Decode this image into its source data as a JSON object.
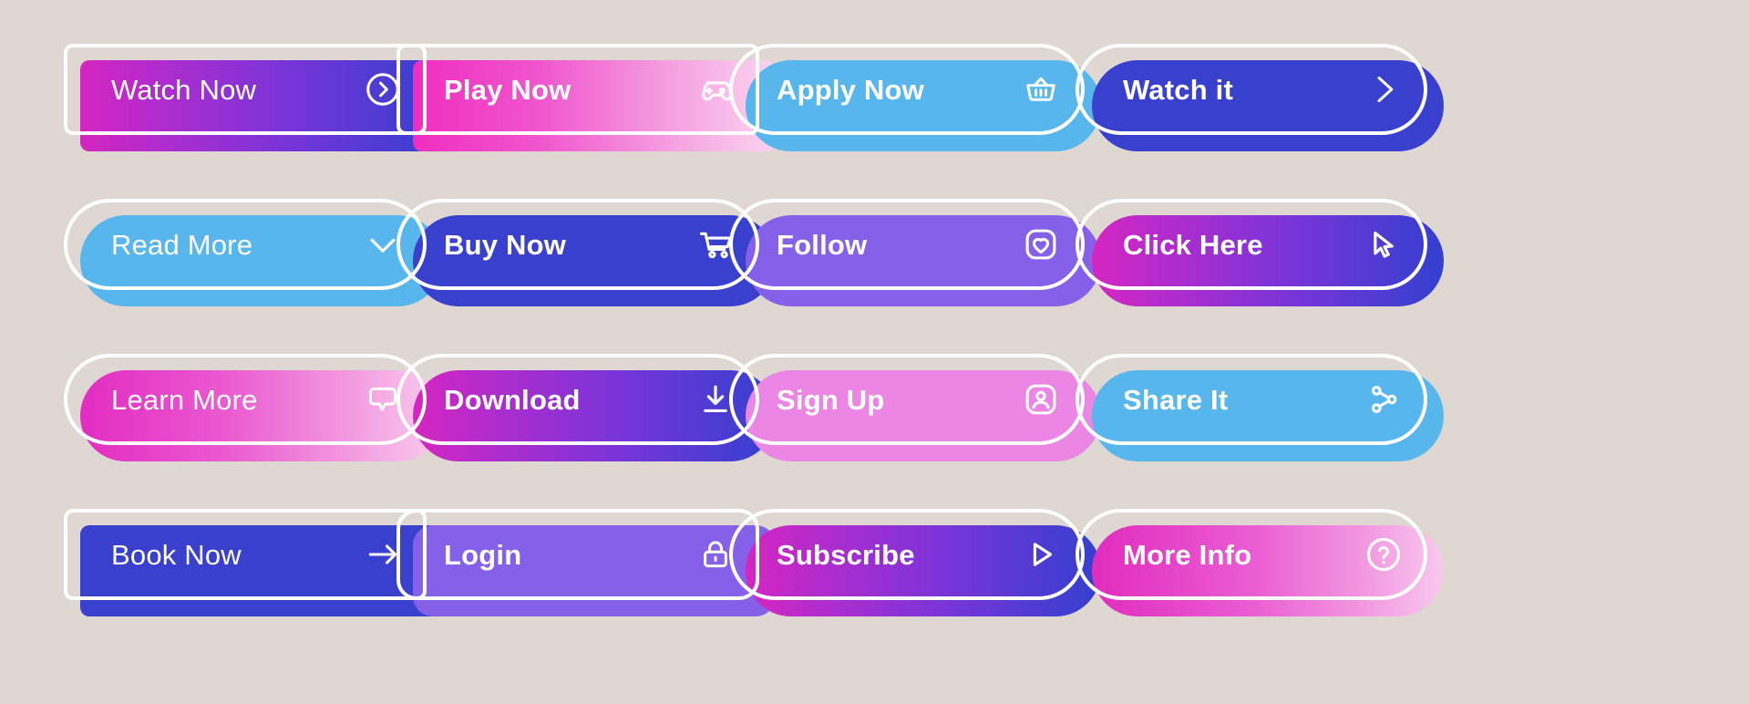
{
  "page": {
    "title": "CTA Button Set",
    "background_color": "#ded7d2",
    "columns": 4,
    "rows": 4,
    "button_count": 16
  },
  "buttons": [
    {
      "label": "Watch Now",
      "icon": "chevron-right-circle-icon",
      "shape": "rounded-small",
      "fill_style": "gradient",
      "colors": [
        "#d526c0",
        "#3340cf"
      ],
      "bold": false,
      "row": 1,
      "col": 1
    },
    {
      "label": "Play Now",
      "icon": "gamepad-icon",
      "shape": "rounded-small",
      "fill_style": "gradient",
      "colors": [
        "#ef2ec0",
        "#fbd4ef"
      ],
      "bold": true,
      "row": 1,
      "col": 2
    },
    {
      "label": "Apply Now",
      "icon": "shopping-basket-icon",
      "shape": "pill",
      "fill_style": "solid",
      "colors": [
        "#57b6ec"
      ],
      "bold": true,
      "row": 1,
      "col": 3
    },
    {
      "label": "Watch it",
      "icon": "chevron-right-icon",
      "shape": "pill",
      "fill_style": "solid",
      "colors": [
        "#3940ce"
      ],
      "bold": true,
      "row": 1,
      "col": 4
    },
    {
      "label": "Read More",
      "icon": "chevron-down-icon",
      "shape": "pill",
      "fill_style": "solid",
      "colors": [
        "#57b6ec"
      ],
      "bold": false,
      "row": 2,
      "col": 1
    },
    {
      "label": "Buy Now",
      "icon": "shopping-cart-icon",
      "shape": "pill",
      "fill_style": "solid",
      "colors": [
        "#3940ce"
      ],
      "bold": true,
      "row": 2,
      "col": 2
    },
    {
      "label": "Follow",
      "icon": "heart-square-icon",
      "shape": "pill",
      "fill_style": "solid",
      "colors": [
        "#8560e8"
      ],
      "bold": true,
      "row": 2,
      "col": 3
    },
    {
      "label": "Click Here",
      "icon": "cursor-pointer-icon",
      "shape": "pill",
      "fill_style": "gradient",
      "colors": [
        "#d526c0",
        "#3340cf"
      ],
      "bold": true,
      "row": 2,
      "col": 4
    },
    {
      "label": "Learn More",
      "icon": "speech-bubble-icon",
      "shape": "pill",
      "fill_style": "gradient",
      "colors": [
        "#e22cc2",
        "#f9cdee"
      ],
      "bold": false,
      "row": 3,
      "col": 1
    },
    {
      "label": "Download",
      "icon": "download-icon",
      "shape": "pill",
      "fill_style": "gradient",
      "colors": [
        "#d526c0",
        "#3340cf"
      ],
      "bold": true,
      "row": 3,
      "col": 2
    },
    {
      "label": "Sign Up",
      "icon": "user-square-icon",
      "shape": "pill",
      "fill_style": "solid",
      "colors": [
        "#eb86e4"
      ],
      "bold": true,
      "row": 3,
      "col": 3
    },
    {
      "label": "Share It",
      "icon": "share-network-icon",
      "shape": "pill",
      "fill_style": "solid",
      "colors": [
        "#57b6ec"
      ],
      "bold": true,
      "row": 3,
      "col": 4
    },
    {
      "label": "Book Now",
      "icon": "arrow-right-icon",
      "shape": "rounded-small",
      "fill_style": "solid",
      "colors": [
        "#3940ce"
      ],
      "bold": false,
      "row": 4,
      "col": 1
    },
    {
      "label": "Login",
      "icon": "lock-icon",
      "shape": "rounded-soft",
      "fill_style": "solid",
      "colors": [
        "#8560e8"
      ],
      "bold": true,
      "row": 4,
      "col": 2
    },
    {
      "label": "Subscribe",
      "icon": "play-triangle-icon",
      "shape": "pill",
      "fill_style": "gradient",
      "colors": [
        "#d526c0",
        "#3340cf"
      ],
      "bold": true,
      "row": 4,
      "col": 3
    },
    {
      "label": "More Info",
      "icon": "question-circle-icon",
      "shape": "pill",
      "fill_style": "gradient",
      "colors": [
        "#e12cbe",
        "#f8c9ee"
      ],
      "bold": true,
      "row": 4,
      "col": 4
    }
  ]
}
